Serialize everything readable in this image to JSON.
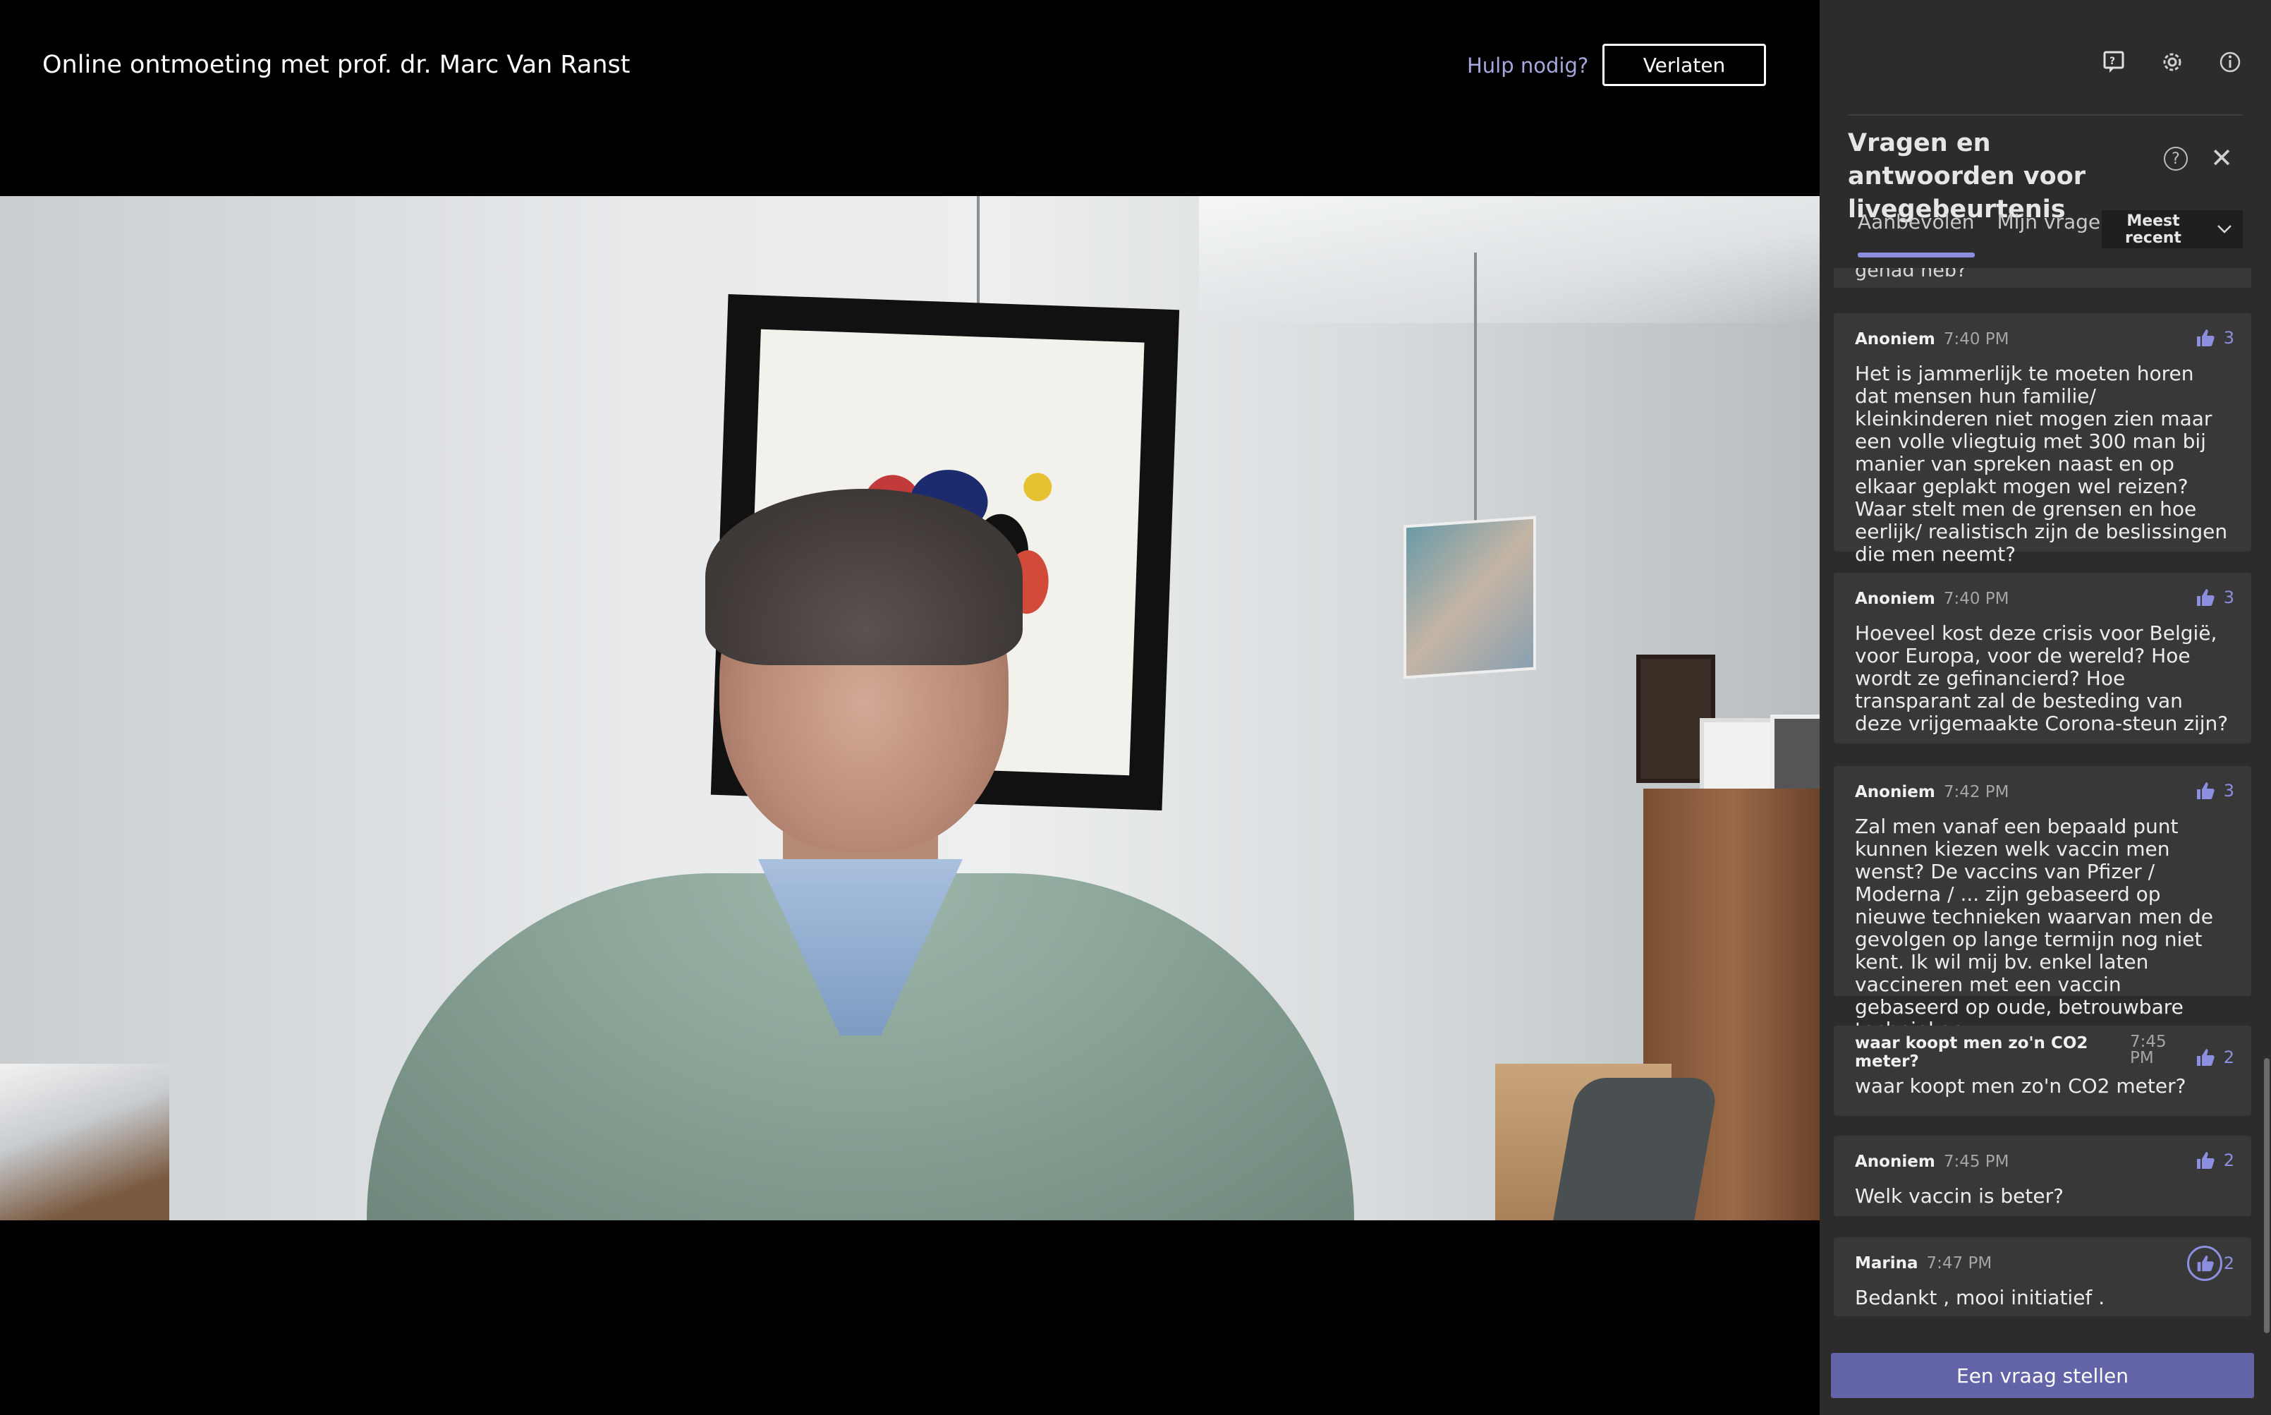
{
  "event": {
    "title": "Online ontmoeting met prof. dr. Marc Van Ranst",
    "help_link": "Hulp nodig?",
    "leave_button": "Verlaten"
  },
  "sidebar": {
    "icons": [
      "qa-icon",
      "gear-icon",
      "info-icon"
    ],
    "title": "Vragen en antwoorden voor livegebeurtenis",
    "tabs": [
      {
        "label": "Aanbevolen",
        "active": true
      },
      {
        "label": "Mijn vragen",
        "active": false
      }
    ],
    "sort": {
      "label": "Meest recent"
    },
    "cut_off_text": "gehad heb?",
    "questions": [
      {
        "author": "Anoniem",
        "time": "7:40 PM",
        "likes": "3",
        "text": "Het is jammerlijk te moeten horen dat mensen hun familie/ kleinkinderen niet mogen zien maar een volle vliegtuig met 300 man bij manier van spreken naast en op elkaar geplakt mogen wel reizen? Waar stelt men de grensen en hoe eerlijk/ realistisch zijn de beslissingen die men neemt?"
      },
      {
        "author": "Anoniem",
        "time": "7:40 PM",
        "likes": "3",
        "text": "Hoeveel kost deze crisis voor België, voor Europa, voor de wereld? Hoe wordt ze gefinancierd? Hoe transparant zal de besteding van deze vrijgemaakte Corona-steun zijn?"
      },
      {
        "author": "Anoniem",
        "time": "7:42 PM",
        "likes": "3",
        "text": "Zal men vanaf een bepaald punt kunnen kiezen welk vaccin men wenst? De vaccins van Pfizer / Moderna / ... zijn gebaseerd op nieuwe technieken waarvan men de gevolgen op lange termijn nog niet kent. Ik wil mij bv. enkel laten vaccineren met een vaccin gebaseerd op oude, betrouwbare technieken"
      },
      {
        "author": "waar koopt men zo'n CO2 meter?",
        "time": "7:45 PM",
        "likes": "2",
        "text": "waar koopt men zo'n CO2 meter?"
      },
      {
        "author": "Anoniem",
        "time": "7:45 PM",
        "likes": "2",
        "text": "Welk vaccin is beter?"
      },
      {
        "author": "Marina",
        "time": "7:47 PM",
        "likes": "2",
        "text": "Bedankt , mooi initiatief ."
      }
    ],
    "ask_button": "Een vraag stellen"
  },
  "colors": {
    "accent": "#6264a7",
    "like": "#8c8ee0",
    "panel_bg": "#2d2c2c",
    "card_bg": "#393838"
  }
}
